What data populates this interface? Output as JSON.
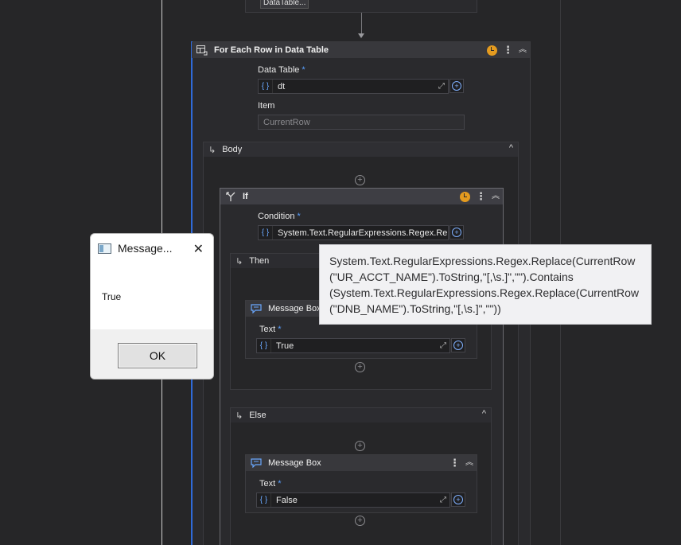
{
  "top_activity": {
    "partial_field": "DataTable..."
  },
  "for_each": {
    "title": "For Each Row in Data Table",
    "data_table_label": "Data Table",
    "data_table_value": "dt",
    "item_label": "Item",
    "item_value": "CurrentRow",
    "required_marker": "*"
  },
  "body_section": {
    "label": "Body"
  },
  "if_activity": {
    "title": "If",
    "condition_label": "Condition",
    "condition_value": "System.Text.RegularExpressions.Regex.Replace(CurrentRow"
  },
  "then_section": {
    "label": "Then",
    "message_box": {
      "title": "Message Box",
      "text_label": "Text",
      "text_value": "True"
    }
  },
  "else_section": {
    "label": "Else",
    "message_box": {
      "title": "Message Box",
      "text_label": "Text",
      "text_value": "False"
    }
  },
  "tooltip": {
    "lines": [
      "System.Text.RegularExpressions.Regex.Replace(CurrentRow",
      "(\"UR_ACCT_NAME\").ToString,\"[,\\s.]\",\"\").Contains",
      "(System.Text.RegularExpressions.Regex.Replace(CurrentRow",
      "(\"DNB_NAME\").ToString,\"[,\\s.]\",\"\"))"
    ]
  },
  "dialog": {
    "title": "Message...",
    "message": "True",
    "ok_label": "OK"
  },
  "icons": {
    "curly": "{ }",
    "expand": "⤢",
    "plus": "+",
    "kebab": "⋮",
    "double_chevron": "︽",
    "chevron_up": "^",
    "branch_arrow": "↳",
    "close": "✕"
  },
  "colors": {
    "canvas": "#262628",
    "accent_blue": "#2f6ad8",
    "warning_orange": "#e49b1f"
  }
}
